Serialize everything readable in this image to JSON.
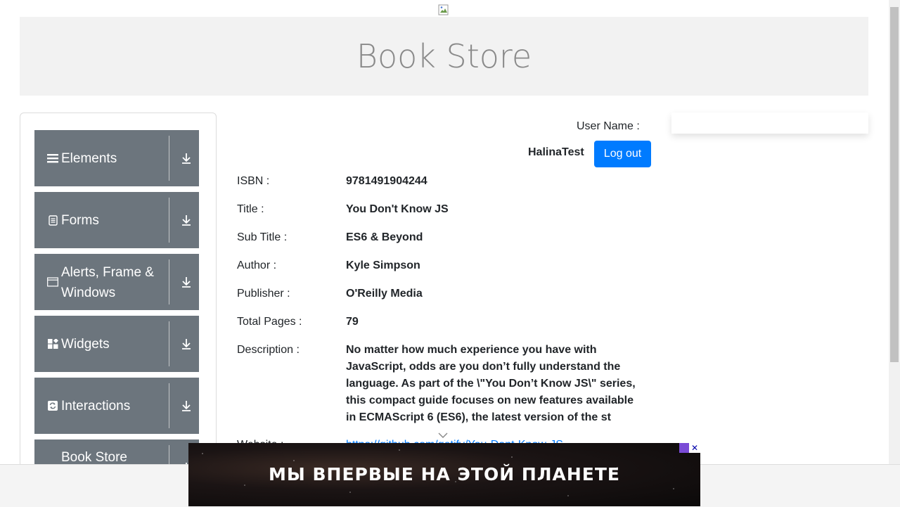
{
  "header": {
    "title": "Book Store"
  },
  "sidebar": {
    "groups": [
      {
        "label": "Elements",
        "icon": "menu-icon"
      },
      {
        "label": "Forms",
        "icon": "form-icon"
      },
      {
        "label": "Alerts, Frame & Windows",
        "icon": "window-icon"
      },
      {
        "label": "Widgets",
        "icon": "widgets-icon"
      },
      {
        "label": "Interactions",
        "icon": "interactions-icon"
      },
      {
        "label": "Book Store Application",
        "icon": "book-icon"
      }
    ]
  },
  "user": {
    "label": "User Name :",
    "value": "HalinaTest",
    "logout_label": "Log out"
  },
  "book": {
    "isbn_label": "ISBN :",
    "isbn": "9781491904244",
    "title_label": "Title :",
    "title": "You Don't Know JS",
    "subtitle_label": "Sub Title :",
    "subtitle": "ES6 & Beyond",
    "author_label": "Author :",
    "author": "Kyle Simpson",
    "publisher_label": "Publisher :",
    "publisher": "O'Reilly Media",
    "pages_label": "Total Pages :",
    "pages": "79",
    "description_label": "Description :",
    "description": "No matter how much experience you have with JavaScript, odds are you don’t fully understand the language. As part of the \\\"You Don’t Know JS\\\" series, this compact guide focuses on new features available in ECMAScript 6 (ES6), the latest version of the st",
    "website_label": "Website :",
    "website": "https://github.com/getify/You-Dont-Know-JS"
  },
  "ad": {
    "text": "МЫ ВПЕРВЫЕ НА ЭТОЙ ПЛАНЕТЕ"
  },
  "colors": {
    "primary": "#007bff",
    "sidebar_group": "#6c757d",
    "header_bg": "#f2f2f2"
  }
}
